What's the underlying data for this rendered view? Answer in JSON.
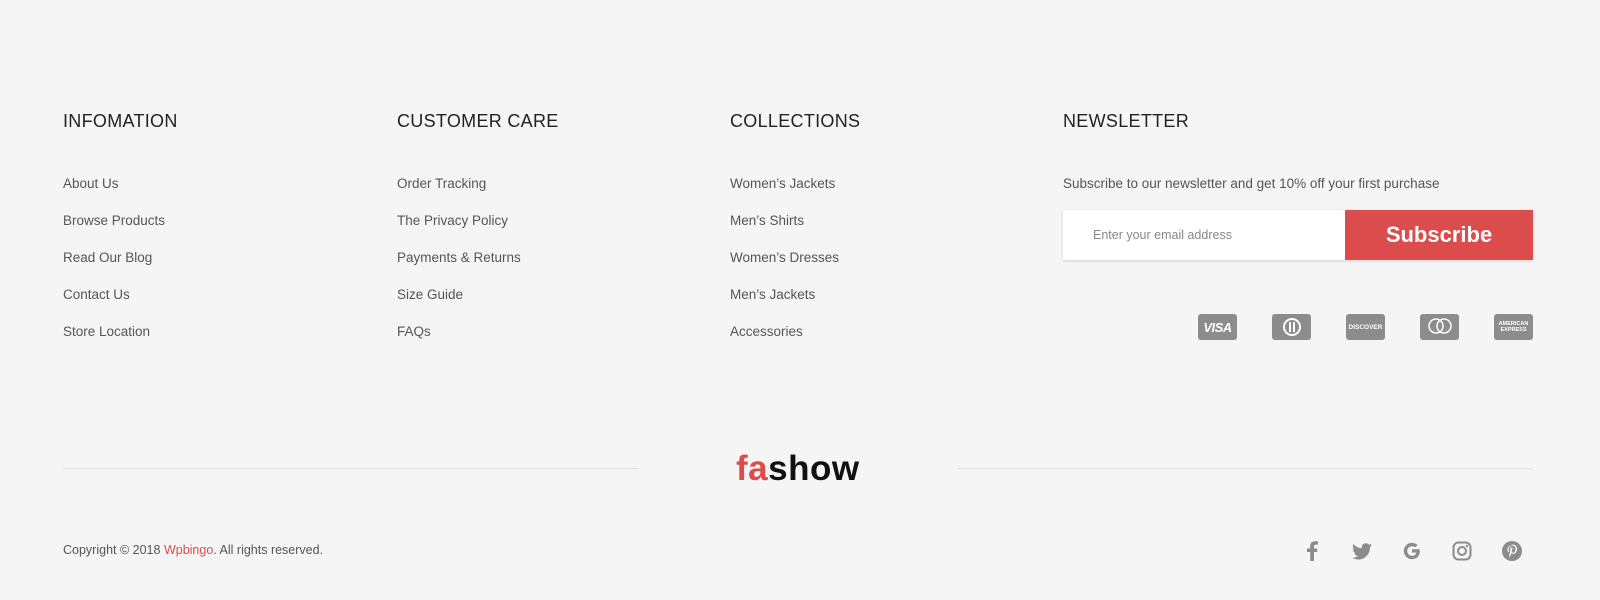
{
  "columns": [
    {
      "title": "INFOMATION",
      "items": [
        "About Us",
        "Browse Products",
        "Read Our Blog",
        "Contact Us",
        "Store Location"
      ]
    },
    {
      "title": "CUSTOMER CARE",
      "items": [
        "Order Tracking",
        "The Privacy Policy",
        "Payments & Returns",
        "Size Guide",
        "FAQs"
      ]
    },
    {
      "title": "COLLECTIONS",
      "items": [
        "Women’s Jackets",
        "Men’s Shirts",
        "Women’s Dresses",
        "Men’s Jackets",
        "Accessories"
      ]
    }
  ],
  "newsletter": {
    "title": "NEWSLETTER",
    "text": "Subscribe to our newsletter and get 10% off your first purchase",
    "placeholder": "Enter your email address",
    "button": "Subscribe"
  },
  "payments": {
    "visa": "VISA",
    "discover": "DISCOVER",
    "amex": "AMERICAN EXPRESS",
    "icons": [
      "visa-icon",
      "diners-club-icon",
      "discover-icon",
      "mastercard-icon",
      "american-express-icon"
    ]
  },
  "logo": {
    "part1": "fa",
    "part2": "show"
  },
  "copyright": {
    "prefix": "Copyright © 2018 ",
    "brand": "Wpbingo",
    "suffix": ". All rights reserved."
  },
  "social": [
    "facebook-icon",
    "twitter-icon",
    "google-icon",
    "instagram-icon",
    "pinterest-icon"
  ],
  "colors": {
    "accent": "#dc4c4c",
    "background": "#f5f5f5",
    "icon_gray": "#8c8c8c"
  }
}
